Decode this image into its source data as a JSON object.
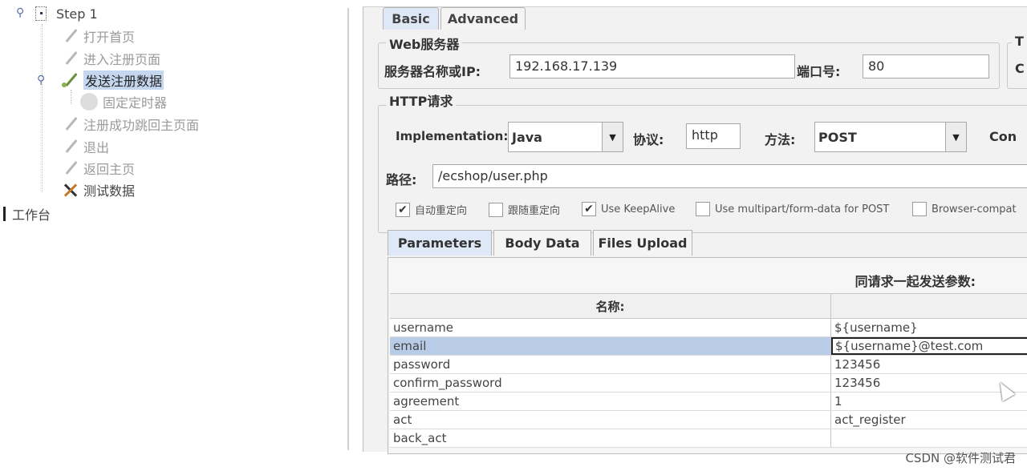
{
  "tree": {
    "items": [
      {
        "label": "Step 1"
      },
      {
        "label": "打开首页"
      },
      {
        "label": "进入注册页面"
      },
      {
        "label": "发送注册数据"
      },
      {
        "label": "固定定时器"
      },
      {
        "label": "注册成功跳回主页面"
      },
      {
        "label": "退出"
      },
      {
        "label": "返回主页"
      },
      {
        "label": "测试数据"
      }
    ],
    "workbench": "工作台"
  },
  "tabs": [
    "Basic",
    "Advanced"
  ],
  "web_server": {
    "title": "Web服务器",
    "server_label": "服务器名称或IP:",
    "server_value": "192.168.17.139",
    "port_label": "端口号:",
    "port_value": "80",
    "timeouts_title_fragment": "T",
    "timeouts_fragment": "C"
  },
  "http_request": {
    "title": "HTTP请求",
    "implementation_label": "Implementation:",
    "implementation_value": "Java",
    "protocol_label": "协议:",
    "protocol_value": "http",
    "method_label": "方法:",
    "method_value": "POST",
    "content_fragment": "Con",
    "path_label": "路径:",
    "path_value": "/ecshop/user.php"
  },
  "options": [
    {
      "label": "自动重定向",
      "checked": true
    },
    {
      "label": "跟随重定向",
      "checked": false
    },
    {
      "label": "Use KeepAlive",
      "checked": true
    },
    {
      "label": "Use multipart/form-data for POST",
      "checked": false
    },
    {
      "label": "Browser-compat",
      "checked": false
    }
  ],
  "subtabs": [
    "Parameters",
    "Body Data",
    "Files Upload"
  ],
  "params": {
    "caption": "同请求一起发送参数:",
    "name_header": "名称:",
    "rows": [
      {
        "name": "username",
        "value": "${username}"
      },
      {
        "name": "email",
        "value": "${username}@test.com"
      },
      {
        "name": "password",
        "value": "123456"
      },
      {
        "name": "confirm_password",
        "value": "123456"
      },
      {
        "name": "agreement",
        "value": "1"
      },
      {
        "name": "act",
        "value": "act_register"
      },
      {
        "name": "back_act",
        "value": ""
      }
    ]
  },
  "watermark": "CSDN @软件测试君"
}
